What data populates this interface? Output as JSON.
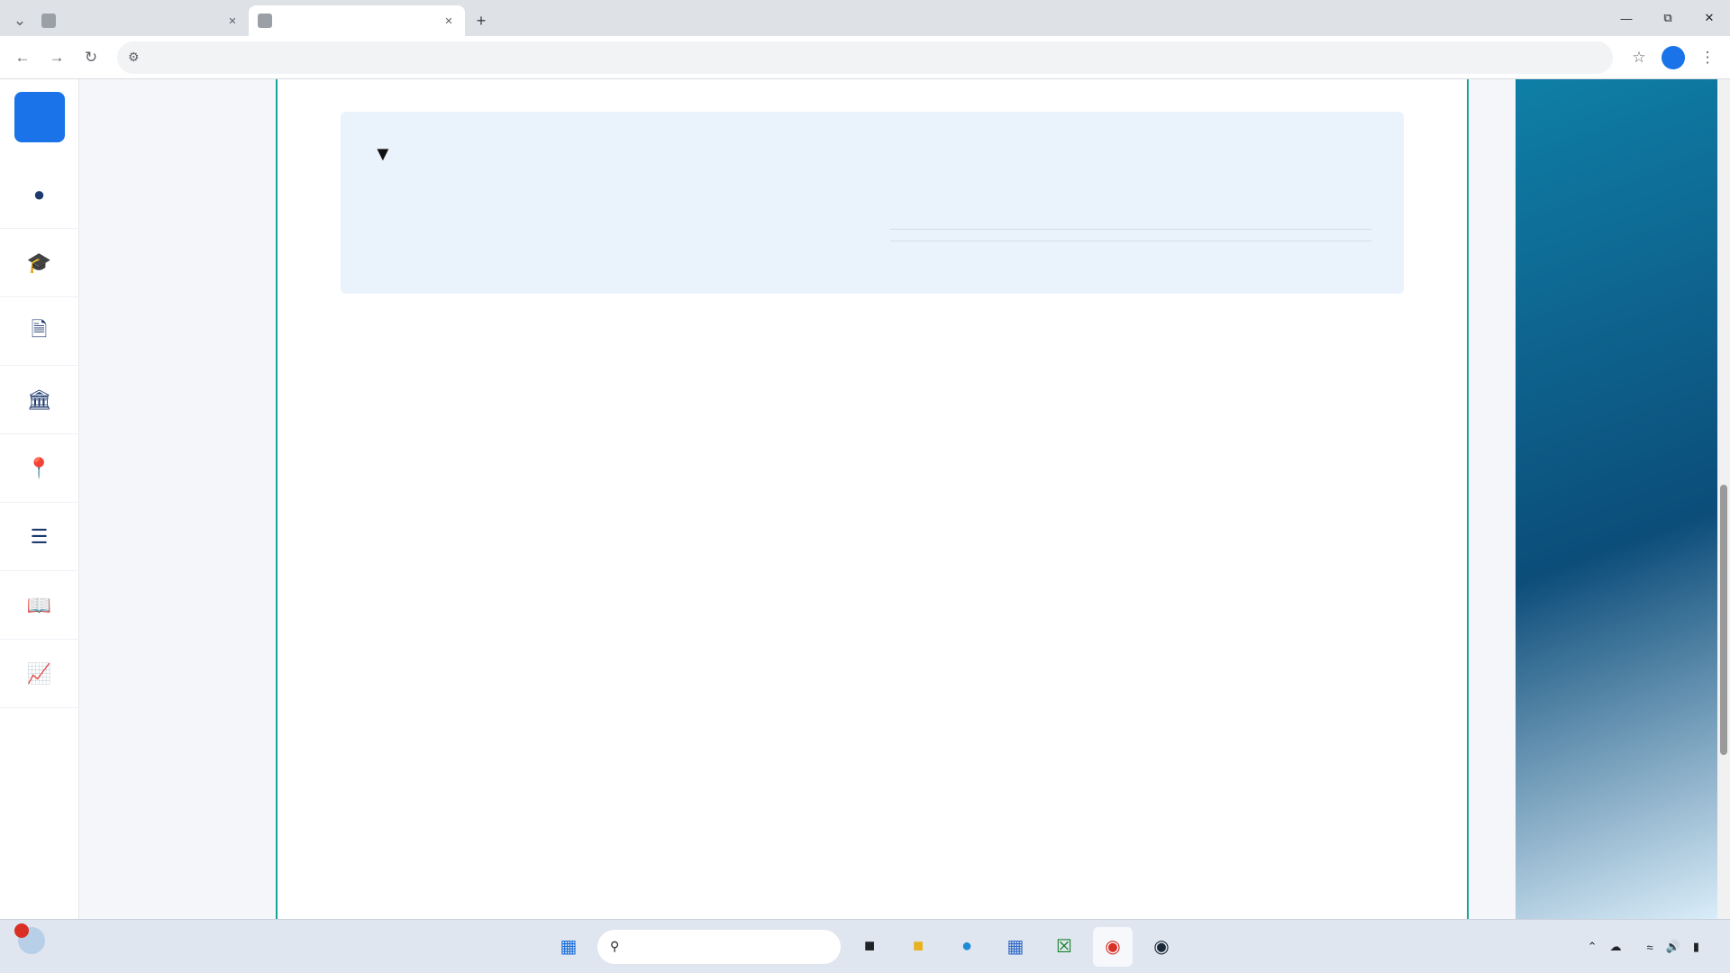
{
  "browser": {
    "tabs": [
      {
        "title": ""
      },
      {
        "title": ""
      }
    ],
    "address_bar": {
      "url": ""
    },
    "profile_initial": ""
  },
  "site": {
    "sections": [
      {
        "heading": "",
        "body": ""
      },
      {
        "heading": "",
        "body": ""
      },
      {
        "heading": "",
        "link": ""
      }
    ],
    "admission_card": {
      "title": "",
      "program_label": "",
      "program_value": "",
      "score_heading": "",
      "rounds": [
        {
          "label": "",
          "min": "",
          "separator": "",
          "max": ""
        },
        {
          "label": "",
          "min": "",
          "separator": "",
          "max": ""
        }
      ],
      "seats_label": "",
      "seats_value": "",
      "method_title": "",
      "weights": [
        {
          "label": "",
          "value": "",
          "fraction": null,
          "color": ""
        },
        {
          "label": "",
          "value": "",
          "fraction": null,
          "color": ""
        }
      ],
      "prediction_title": "",
      "prediction_range": "",
      "note_label": "",
      "note_text": ""
    }
  },
  "taskbar": {
    "weather": {
      "badge": "",
      "temperature": "",
      "condition": ""
    },
    "search_placeholder": "",
    "tray": {
      "language": "",
      "time": "",
      "date": ""
    }
  }
}
